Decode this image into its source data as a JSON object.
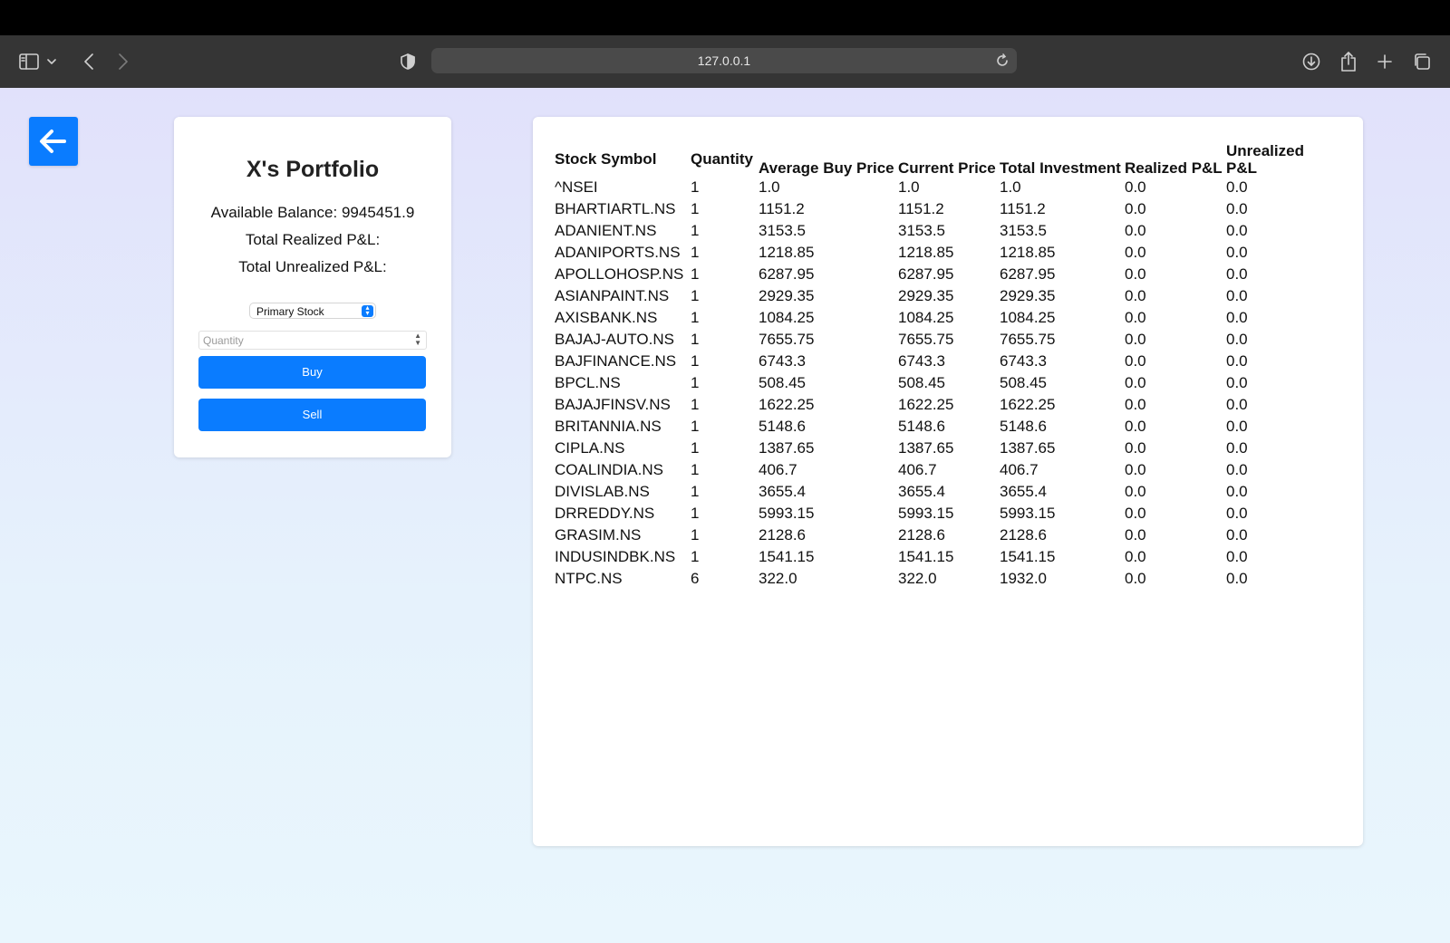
{
  "browser": {
    "url": "127.0.0.1"
  },
  "portfolio": {
    "title": "X's Portfolio",
    "available_balance": "Available Balance: 9945451.9",
    "total_realized": "Total Realized P&L:",
    "total_unrealized": "Total Unrealized P&L:",
    "stock_select_value": "Primary Stock",
    "quantity_placeholder": "Quantity",
    "buy_label": "Buy",
    "sell_label": "Sell"
  },
  "holdings": {
    "headers": [
      "Stock Symbol",
      "Quantity",
      "Average Buy Price",
      "Current Price",
      "Total Investment",
      "Realized P&L",
      "Unrealized P&L"
    ],
    "rows": [
      [
        "^NSEI",
        "1",
        "1.0",
        "1.0",
        "1.0",
        "0.0",
        "0.0"
      ],
      [
        "BHARTIARTL.NS",
        "1",
        "1151.2",
        "1151.2",
        "1151.2",
        "0.0",
        "0.0"
      ],
      [
        "ADANIENT.NS",
        "1",
        "3153.5",
        "3153.5",
        "3153.5",
        "0.0",
        "0.0"
      ],
      [
        "ADANIPORTS.NS",
        "1",
        "1218.85",
        "1218.85",
        "1218.85",
        "0.0",
        "0.0"
      ],
      [
        "APOLLOHOSP.NS",
        "1",
        "6287.95",
        "6287.95",
        "6287.95",
        "0.0",
        "0.0"
      ],
      [
        "ASIANPAINT.NS",
        "1",
        "2929.35",
        "2929.35",
        "2929.35",
        "0.0",
        "0.0"
      ],
      [
        "AXISBANK.NS",
        "1",
        "1084.25",
        "1084.25",
        "1084.25",
        "0.0",
        "0.0"
      ],
      [
        "BAJAJ-AUTO.NS",
        "1",
        "7655.75",
        "7655.75",
        "7655.75",
        "0.0",
        "0.0"
      ],
      [
        "BAJFINANCE.NS",
        "1",
        "6743.3",
        "6743.3",
        "6743.3",
        "0.0",
        "0.0"
      ],
      [
        "BPCL.NS",
        "1",
        "508.45",
        "508.45",
        "508.45",
        "0.0",
        "0.0"
      ],
      [
        "BAJAJFINSV.NS",
        "1",
        "1622.25",
        "1622.25",
        "1622.25",
        "0.0",
        "0.0"
      ],
      [
        "BRITANNIA.NS",
        "1",
        "5148.6",
        "5148.6",
        "5148.6",
        "0.0",
        "0.0"
      ],
      [
        "CIPLA.NS",
        "1",
        "1387.65",
        "1387.65",
        "1387.65",
        "0.0",
        "0.0"
      ],
      [
        "COALINDIA.NS",
        "1",
        "406.7",
        "406.7",
        "406.7",
        "0.0",
        "0.0"
      ],
      [
        "DIVISLAB.NS",
        "1",
        "3655.4",
        "3655.4",
        "3655.4",
        "0.0",
        "0.0"
      ],
      [
        "DRREDDY.NS",
        "1",
        "5993.15",
        "5993.15",
        "5993.15",
        "0.0",
        "0.0"
      ],
      [
        "GRASIM.NS",
        "1",
        "2128.6",
        "2128.6",
        "2128.6",
        "0.0",
        "0.0"
      ],
      [
        "INDUSINDBK.NS",
        "1",
        "1541.15",
        "1541.15",
        "1541.15",
        "0.0",
        "0.0"
      ],
      [
        "NTPC.NS",
        "6",
        "322.0",
        "322.0",
        "1932.0",
        "0.0",
        "0.0"
      ]
    ]
  },
  "colors": {
    "accent": "#0a7cff",
    "toolbar": "#353535"
  }
}
